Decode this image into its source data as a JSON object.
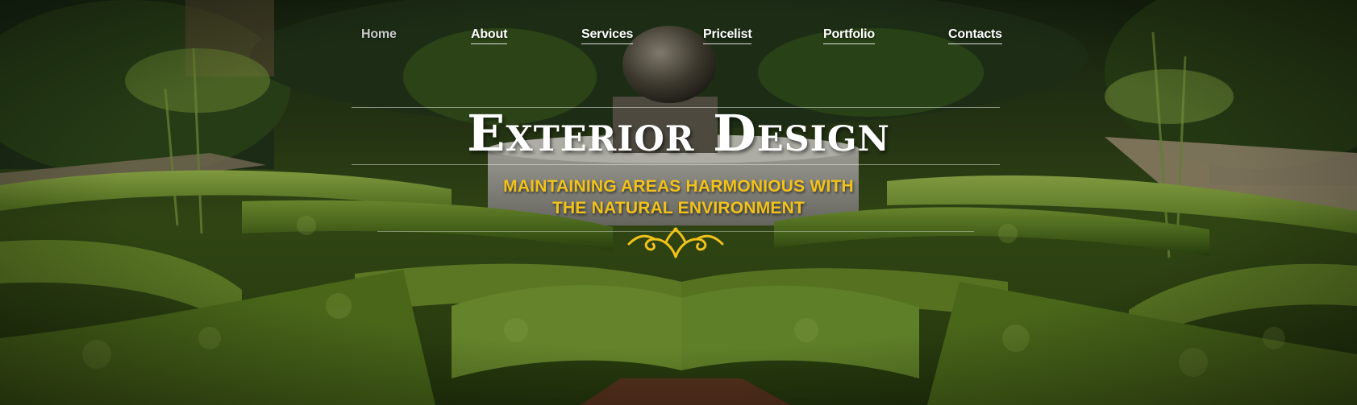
{
  "nav": {
    "items": [
      {
        "label": "Home",
        "active": true
      },
      {
        "label": "About",
        "active": false
      },
      {
        "label": "Services",
        "active": false
      },
      {
        "label": "Pricelist",
        "active": false
      },
      {
        "label": "Portfolio",
        "active": false
      },
      {
        "label": "Contacts",
        "active": false
      }
    ]
  },
  "hero": {
    "title": "Exterior Design",
    "subtitle_line1": "MAINTAINING AREAS HARMONIOUS WITH",
    "subtitle_line2": "THE NATURAL ENVIRONMENT",
    "background_image": "hedge-maze-garden",
    "ornament_icon": "flourish-ornament-icon"
  },
  "colors": {
    "accent": "#f2c21b",
    "nav_text": "#ffffff",
    "nav_active": "#c9c9c9",
    "hedge_dark": "#2e4414",
    "hedge_light": "#6f8f2c"
  }
}
